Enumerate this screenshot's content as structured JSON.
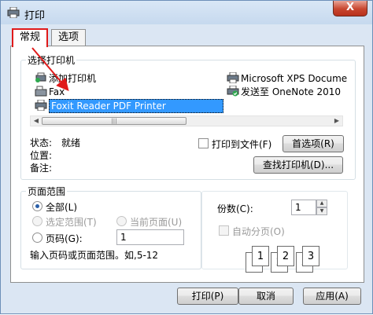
{
  "window": {
    "title": "打印",
    "close_label": "X"
  },
  "tabs": [
    {
      "label": "常规"
    },
    {
      "label": "选项"
    }
  ],
  "select_printer": {
    "title": "选择打印机",
    "printers": [
      {
        "name": "添加打印机"
      },
      {
        "name": "Fax"
      },
      {
        "name": "Foxit Reader PDF Printer"
      },
      {
        "name": "Microsoft XPS Docume"
      },
      {
        "name": "发送至 OneNote 2010"
      }
    ],
    "status_label": "状态:",
    "status_value": "就绪",
    "location_label": "位置:",
    "comment_label": "备注:",
    "print_to_file_label": "打印到文件(F)",
    "preferences_button": "首选项(R)",
    "find_printer_button": "查找打印机(D)..."
  },
  "page_range": {
    "title": "页面范围",
    "all_label": "全部(L)",
    "selection_label": "选定范围(T)",
    "current_page_label": "当前页面(U)",
    "pages_label": "页码(G):",
    "pages_value": "1",
    "hint": "输入页码或页面范围。如,5-12"
  },
  "copies": {
    "label": "份数(C):",
    "value": "1",
    "collate_label": "自动分页(O)",
    "collate_icons": [
      "1",
      "1",
      "2",
      "2",
      "3",
      "3"
    ]
  },
  "footer": {
    "print_button": "打印(P)",
    "cancel_button": "取消",
    "apply_button": "应用(A)"
  },
  "colors": {
    "accent": "#3399ff",
    "annotation": "#e01a1a"
  }
}
